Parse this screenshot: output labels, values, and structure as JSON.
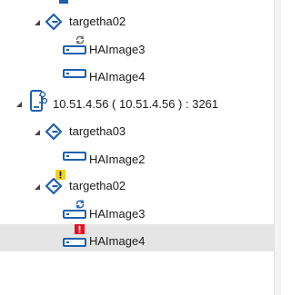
{
  "tree": {
    "nodes": [
      {
        "key": "n1",
        "label": "targetha02",
        "type": "target",
        "expanded": true,
        "status": "none"
      },
      {
        "key": "n2",
        "label": "HAImage3",
        "type": "image",
        "status": "syncing"
      },
      {
        "key": "n3",
        "label": "HAImage4",
        "type": "image",
        "status": "none"
      },
      {
        "key": "n4",
        "label": "10.51.4.56 ( 10.51.4.56 ) : 3261",
        "type": "server",
        "expanded": true,
        "status": "none"
      },
      {
        "key": "n5",
        "label": "targetha03",
        "type": "target",
        "expanded": true,
        "status": "none"
      },
      {
        "key": "n6",
        "label": "HAImage2",
        "type": "image",
        "status": "none"
      },
      {
        "key": "n7",
        "label": "targetha02",
        "type": "target",
        "expanded": true,
        "status": "warning"
      },
      {
        "key": "n8",
        "label": "HAImage3",
        "type": "image",
        "status": "syncing"
      },
      {
        "key": "n9",
        "label": "HAImage4",
        "type": "image",
        "status": "error",
        "selected": true
      }
    ]
  },
  "colors": {
    "icon_blue": "#1f5fae",
    "warning_yellow": "#f3d21a",
    "error_red": "#e81123",
    "selection_bg": "#e5e5e5",
    "sync_gray": "#707070"
  },
  "icons": {
    "target": "target-diamond-icon",
    "image": "disk-image-icon",
    "server": "server-device-icon",
    "syncing": "sync-icon",
    "warning": "warning-icon",
    "error": "error-icon",
    "expanded": "expanded-triangle-icon"
  }
}
